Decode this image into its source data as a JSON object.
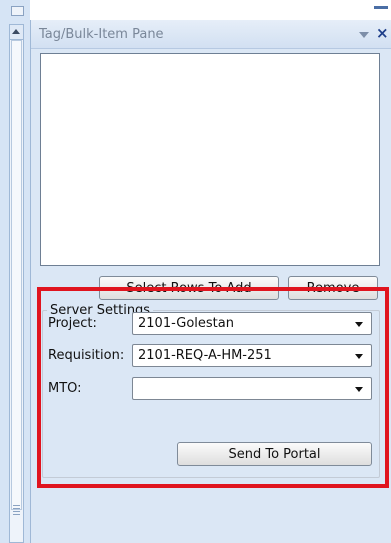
{
  "pane": {
    "title": "Tag/Bulk-Item Pane",
    "dropdown_icon": "chevron-down-icon",
    "close_icon": "close-icon",
    "close_glyph": "×"
  },
  "toolbar": {
    "select_rows_label": "Select Rows To Add",
    "remove_label": "Remove"
  },
  "server_settings": {
    "title": "Server Settings",
    "project_label": "Project:",
    "project_value": "2101-Golestan",
    "requisition_label": "Requisition:",
    "requisition_value": "2101-REQ-A-HM-251",
    "mto_label": "MTO:",
    "mto_value": "",
    "send_label": "Send To Portal"
  },
  "colors": {
    "highlight_frame": "#e0141e",
    "pane_background": "#dbe7f5"
  }
}
